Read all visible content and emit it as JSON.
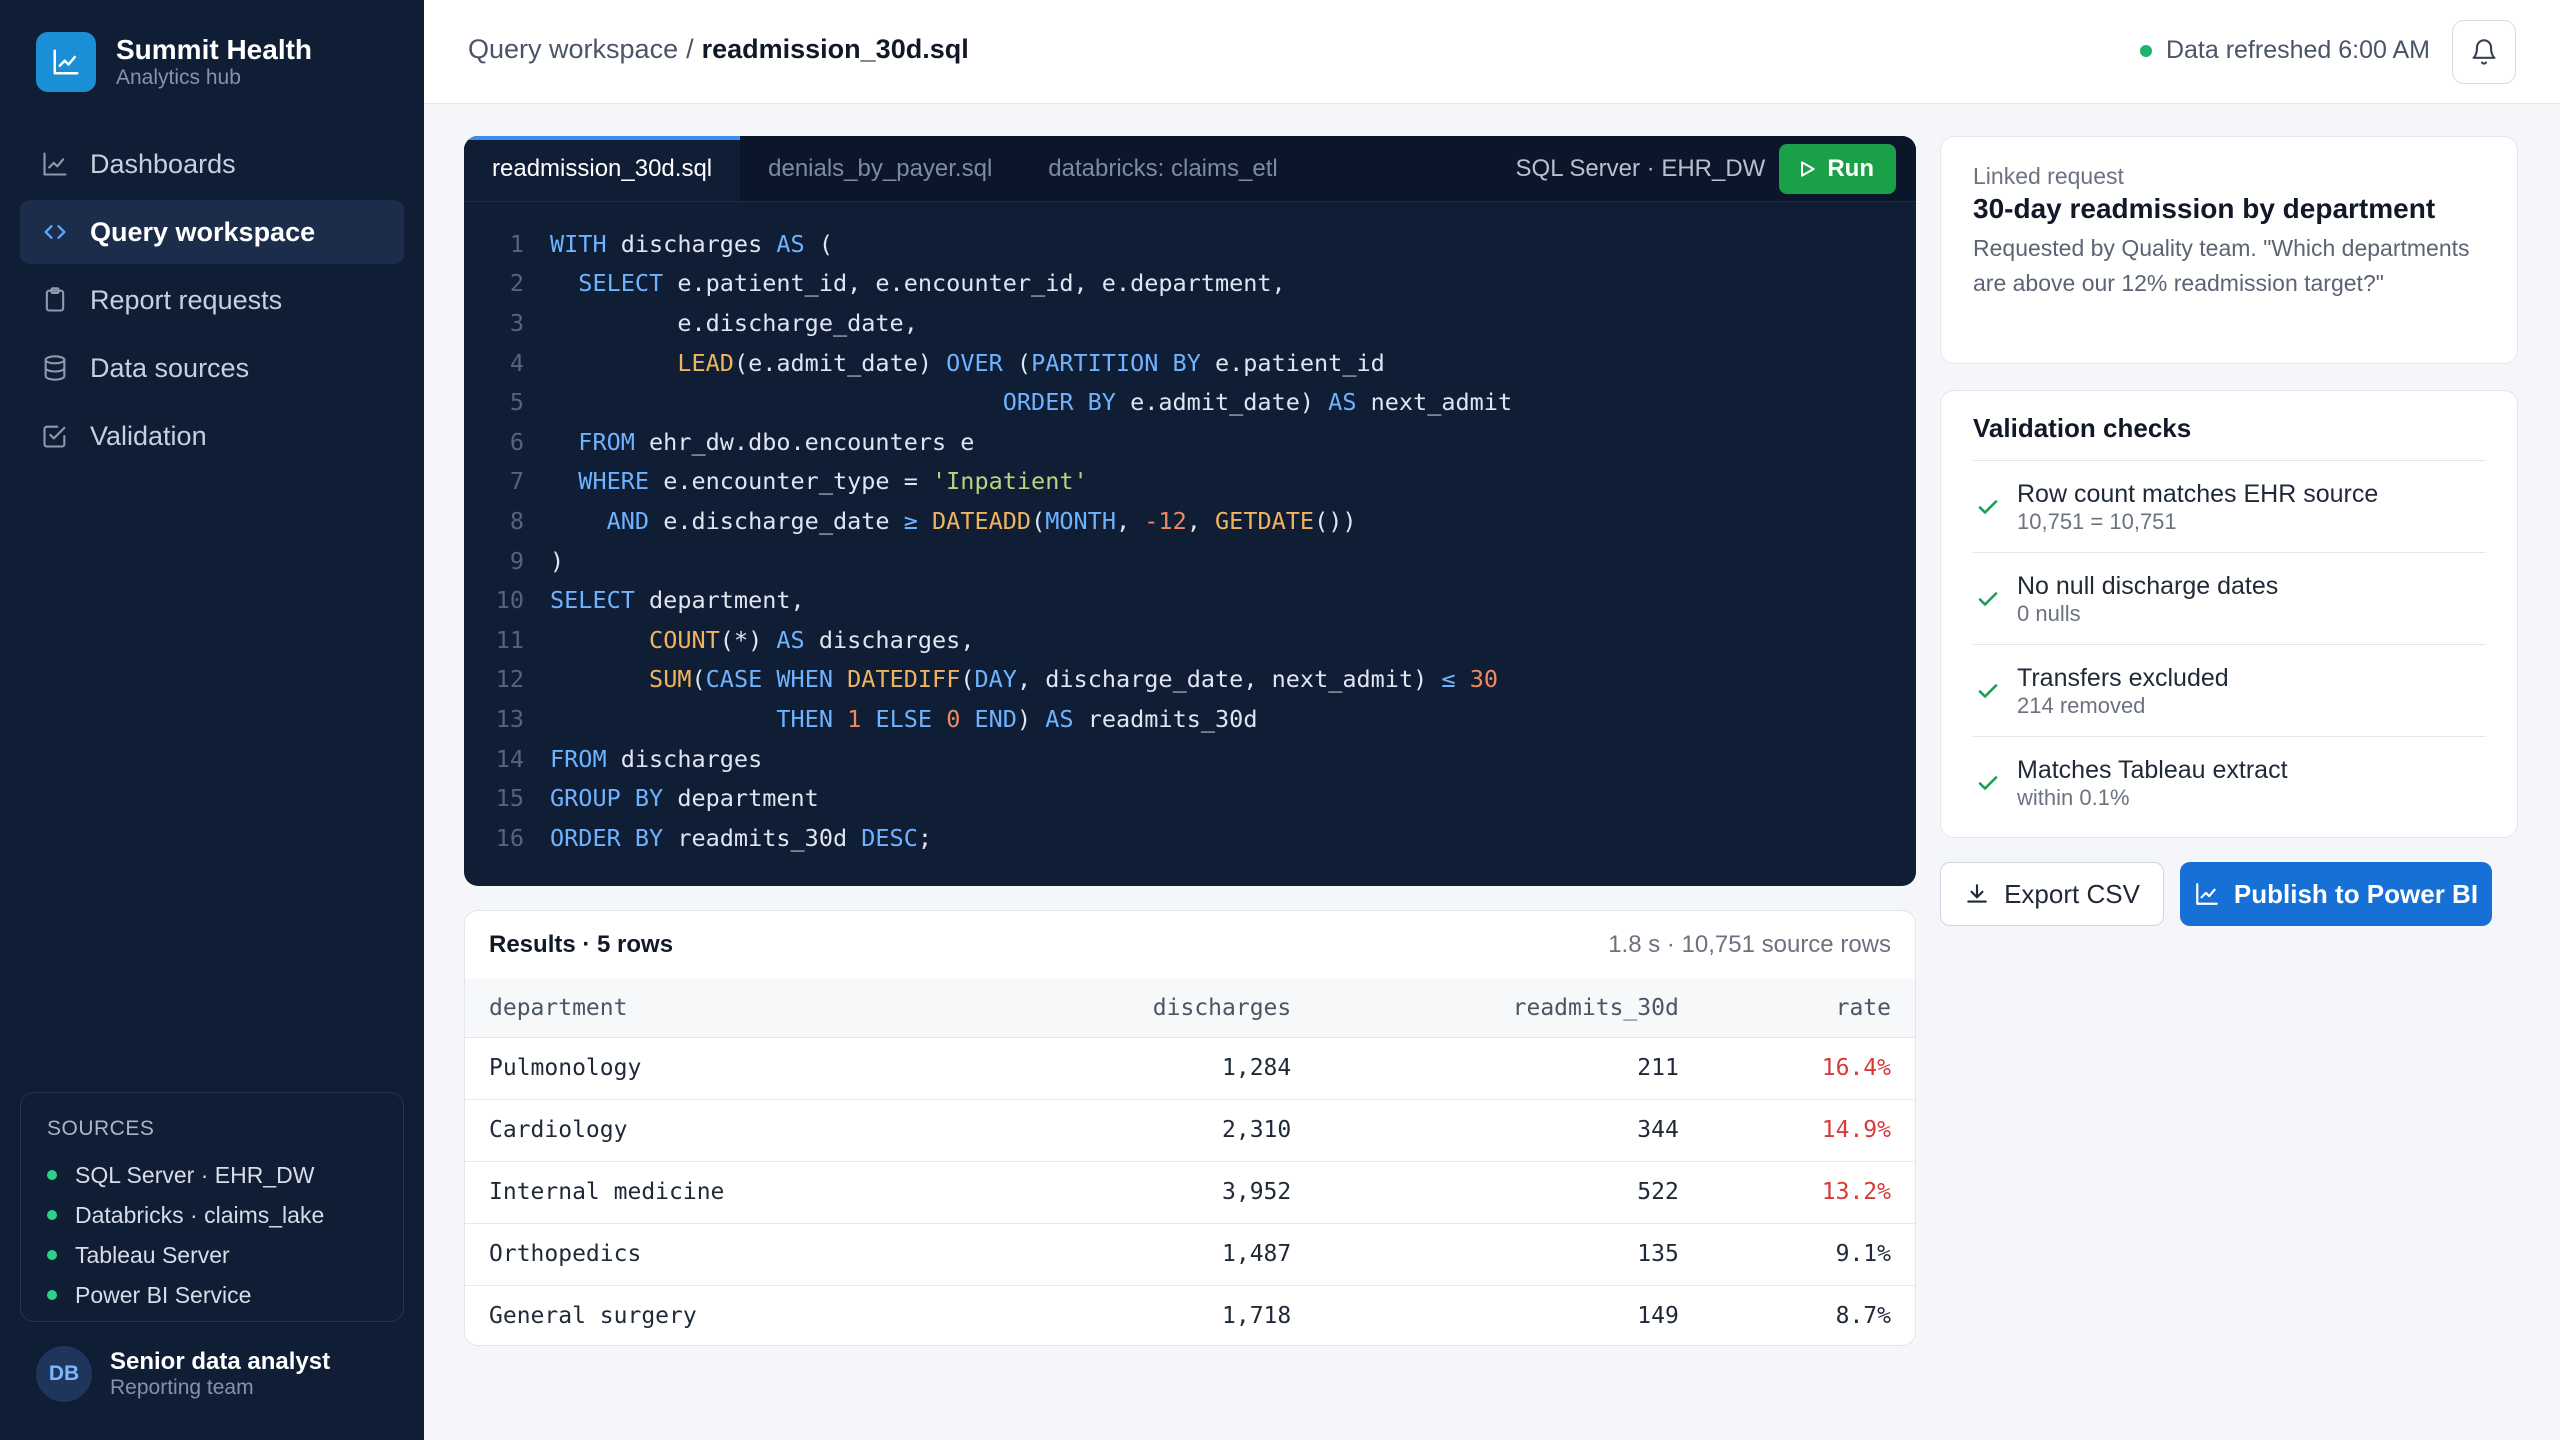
{
  "brand": {
    "name": "Summit Health",
    "subtitle": "Analytics hub"
  },
  "nav": [
    {
      "label": "Dashboards",
      "icon": "chart-line-icon"
    },
    {
      "label": "Query workspace",
      "icon": "code-icon",
      "active": true
    },
    {
      "label": "Report requests",
      "icon": "clipboard-icon"
    },
    {
      "label": "Data sources",
      "icon": "database-icon"
    },
    {
      "label": "Validation",
      "icon": "check-square-icon"
    }
  ],
  "sources": {
    "title": "SOURCES",
    "items": [
      "SQL Server · EHR_DW",
      "Databricks · claims_lake",
      "Tableau Server",
      "Power BI Service"
    ]
  },
  "user": {
    "initials": "DB",
    "name": "Senior data analyst",
    "team": "Reporting team"
  },
  "header": {
    "breadcrumb_parent": "Query workspace",
    "breadcrumb_sep": "/",
    "breadcrumb_current": "readmission_30d.sql",
    "refresh_text": "Data refreshed 6:00 AM"
  },
  "editor": {
    "tabs": [
      "readmission_30d.sql",
      "denials_by_payer.sql",
      "databricks: claims_etl"
    ],
    "connection": "SQL Server · EHR_DW",
    "run_label": "Run",
    "lines": [
      [
        [
          "k",
          "WITH"
        ],
        [
          "t",
          " discharges "
        ],
        [
          "k",
          "AS"
        ],
        [
          "t",
          " ("
        ]
      ],
      [
        [
          "t",
          "  "
        ],
        [
          "k",
          "SELECT"
        ],
        [
          "t",
          " e.patient_id, e.encounter_id, e.department,"
        ]
      ],
      [
        [
          "t",
          "         e.discharge_date,"
        ]
      ],
      [
        [
          "t",
          "         "
        ],
        [
          "f",
          "LEAD"
        ],
        [
          "t",
          "(e.admit_date) "
        ],
        [
          "k",
          "OVER"
        ],
        [
          "t",
          " ("
        ],
        [
          "k",
          "PARTITION BY"
        ],
        [
          "t",
          " e.patient_id"
        ]
      ],
      [
        [
          "t",
          "                                "
        ],
        [
          "k",
          "ORDER BY"
        ],
        [
          "t",
          " e.admit_date) "
        ],
        [
          "k",
          "AS"
        ],
        [
          "t",
          " next_admit"
        ]
      ],
      [
        [
          "t",
          "  "
        ],
        [
          "k",
          "FROM"
        ],
        [
          "t",
          " ehr_dw.dbo.encounters e"
        ]
      ],
      [
        [
          "t",
          "  "
        ],
        [
          "k",
          "WHERE"
        ],
        [
          "t",
          " e.encounter_type = "
        ],
        [
          "s",
          "'Inpatient'"
        ]
      ],
      [
        [
          "t",
          "    "
        ],
        [
          "k",
          "AND"
        ],
        [
          "t",
          " e.discharge_date "
        ],
        [
          "k",
          "≥"
        ],
        [
          "t",
          " "
        ],
        [
          "f",
          "DATEADD"
        ],
        [
          "t",
          "("
        ],
        [
          "k",
          "MONTH"
        ],
        [
          "t",
          ", "
        ],
        [
          "n",
          "-12"
        ],
        [
          "t",
          ", "
        ],
        [
          "f",
          "GETDATE"
        ],
        [
          "t",
          "())"
        ]
      ],
      [
        [
          "t",
          ")"
        ]
      ],
      [
        [
          "k",
          "SELECT"
        ],
        [
          "t",
          " department,"
        ]
      ],
      [
        [
          "t",
          "       "
        ],
        [
          "f",
          "COUNT"
        ],
        [
          "t",
          "(*) "
        ],
        [
          "k",
          "AS"
        ],
        [
          "t",
          " discharges,"
        ]
      ],
      [
        [
          "t",
          "       "
        ],
        [
          "f",
          "SUM"
        ],
        [
          "t",
          "("
        ],
        [
          "k",
          "CASE WHEN"
        ],
        [
          "t",
          " "
        ],
        [
          "f",
          "DATEDIFF"
        ],
        [
          "t",
          "("
        ],
        [
          "k",
          "DAY"
        ],
        [
          "t",
          ", discharge_date, next_admit) "
        ],
        [
          "k",
          "≤"
        ],
        [
          "t",
          " "
        ],
        [
          "n",
          "30"
        ]
      ],
      [
        [
          "t",
          "                "
        ],
        [
          "k",
          "THEN"
        ],
        [
          "t",
          " "
        ],
        [
          "n",
          "1"
        ],
        [
          "t",
          " "
        ],
        [
          "k",
          "ELSE"
        ],
        [
          "t",
          " "
        ],
        [
          "n",
          "0"
        ],
        [
          "t",
          " "
        ],
        [
          "k",
          "END"
        ],
        [
          "t",
          ") "
        ],
        [
          "k",
          "AS"
        ],
        [
          "t",
          " readmits_30d"
        ]
      ],
      [
        [
          "k",
          "FROM"
        ],
        [
          "t",
          " discharges"
        ]
      ],
      [
        [
          "k",
          "GROUP BY"
        ],
        [
          "t",
          " department"
        ]
      ],
      [
        [
          "k",
          "ORDER BY"
        ],
        [
          "t",
          " readmits_30d "
        ],
        [
          "k",
          "DESC"
        ],
        [
          "t",
          ";"
        ]
      ]
    ]
  },
  "results": {
    "title": "Results · 5 rows",
    "meta": "1.8 s · 10,751 source rows",
    "columns": [
      "department",
      "discharges",
      "readmits_30d",
      "rate"
    ],
    "rows": [
      {
        "department": "Pulmonology",
        "discharges": "1,284",
        "readmits": "211",
        "rate": "16.4%",
        "flag": true
      },
      {
        "department": "Cardiology",
        "discharges": "2,310",
        "readmits": "344",
        "rate": "14.9%",
        "flag": true
      },
      {
        "department": "Internal medicine",
        "discharges": "3,952",
        "readmits": "522",
        "rate": "13.2%",
        "flag": true
      },
      {
        "department": "Orthopedics",
        "discharges": "1,487",
        "readmits": "135",
        "rate": "9.1%",
        "flag": false
      },
      {
        "department": "General surgery",
        "discharges": "1,718",
        "readmits": "149",
        "rate": "8.7%",
        "flag": false
      }
    ]
  },
  "request": {
    "label": "Linked request",
    "title": "30-day readmission by department",
    "description": "Requested by Quality team. \"Which departments are above our 12% readmission target?\""
  },
  "validation": {
    "title": "Validation checks",
    "items": [
      {
        "title": "Row count matches EHR source",
        "detail": "10,751 = 10,751"
      },
      {
        "title": "No null discharge dates",
        "detail": "0 nulls"
      },
      {
        "title": "Transfers excluded",
        "detail": "214 removed"
      },
      {
        "title": "Matches Tableau extract",
        "detail": "within 0.1%"
      }
    ]
  },
  "actions": {
    "export_label": "Export CSV",
    "publish_label": "Publish to Power BI"
  },
  "colors": {
    "accent": "#1670d6",
    "run": "#1aa148",
    "alert": "#d63a3a",
    "ok": "#1db36b",
    "sidebar": "#0f1d35"
  }
}
